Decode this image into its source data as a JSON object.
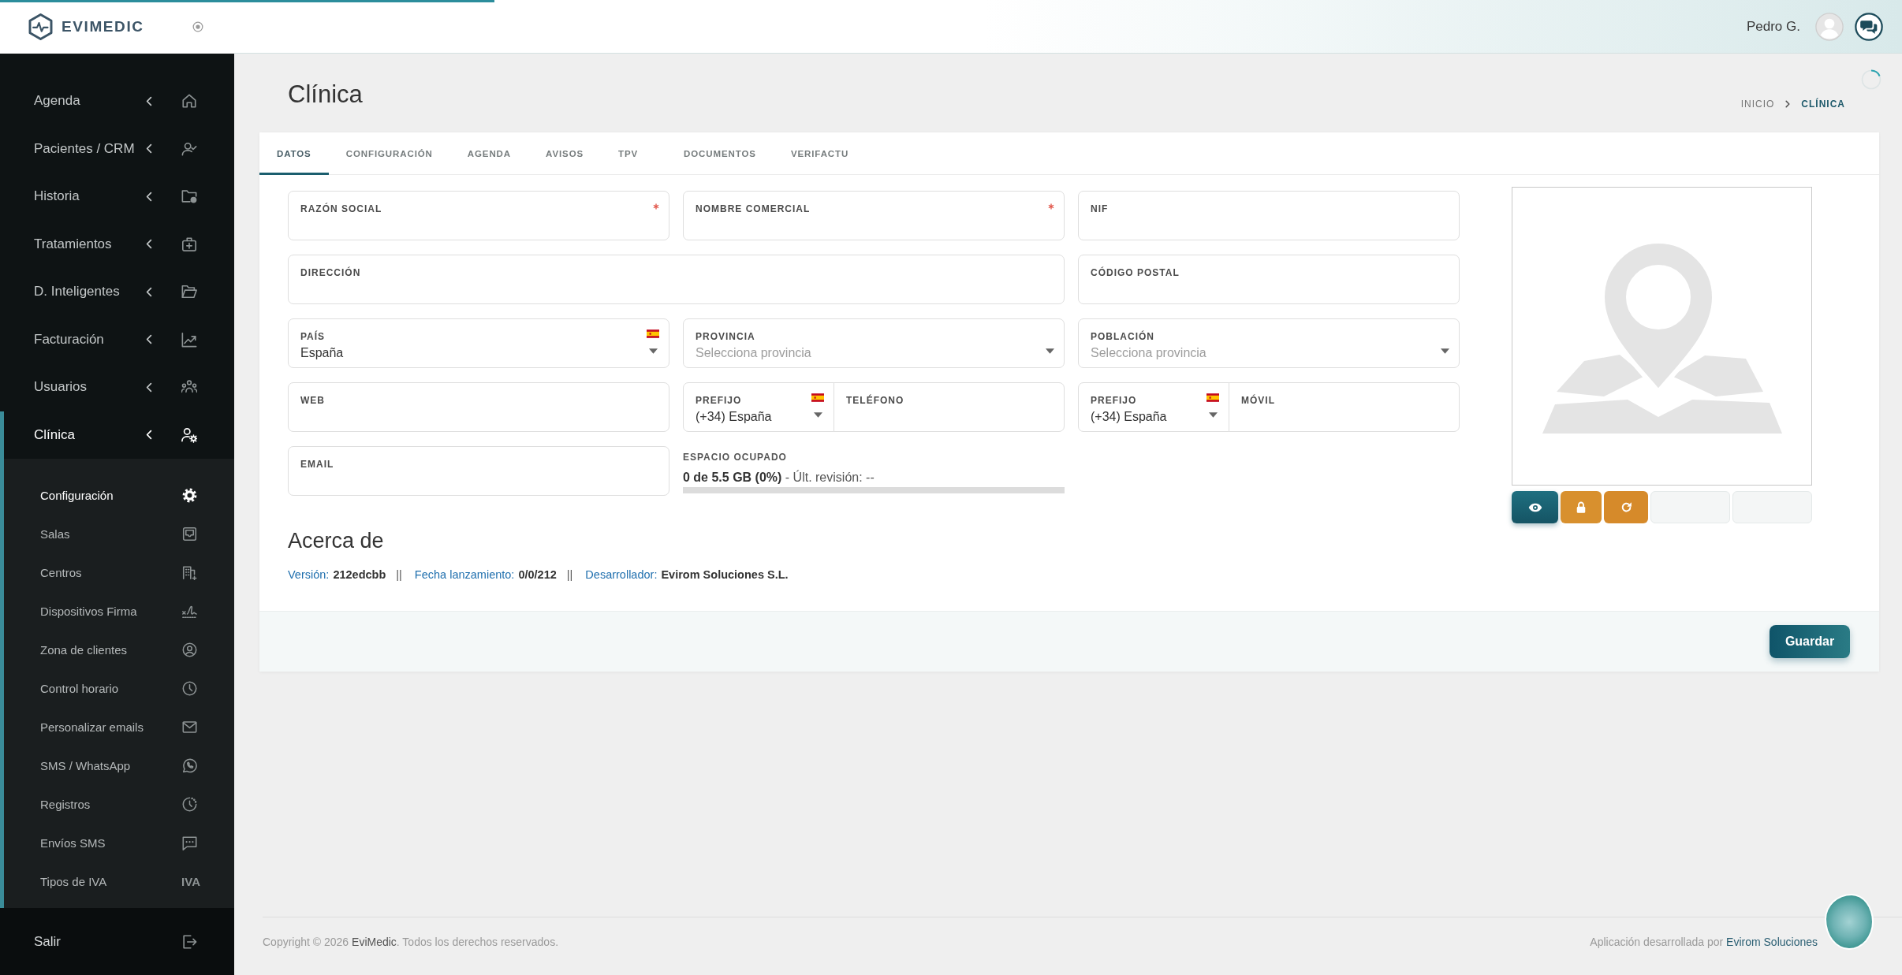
{
  "progress": {
    "level": 0.26
  },
  "brand": {
    "name": "EVIMEDIC"
  },
  "sidebar": {
    "items": [
      {
        "label": "Agenda",
        "selected": false
      },
      {
        "label": "Pacientes / CRM",
        "selected": false
      },
      {
        "label": "Historia",
        "selected": false
      },
      {
        "label": "Tratamientos",
        "selected": false
      },
      {
        "label": "D. Inteligentes",
        "selected": false
      },
      {
        "label": "Facturación",
        "selected": false
      },
      {
        "label": "Usuarios",
        "selected": false
      },
      {
        "label": "Clínica",
        "selected": true,
        "children": [
          {
            "label": "Configuración",
            "selected": true
          },
          {
            "label": "Salas",
            "selected": false
          },
          {
            "label": "Centros",
            "selected": false
          },
          {
            "label": "Dispositivos Firma",
            "selected": false
          },
          {
            "label": "Zona de clientes",
            "selected": false
          },
          {
            "label": "Control horario",
            "selected": false
          },
          {
            "label": "Personalizar emails",
            "selected": false
          },
          {
            "label": "SMS / WhatsApp",
            "selected": false
          },
          {
            "label": "Registros",
            "selected": false
          },
          {
            "label": "Envíos SMS",
            "selected": false
          },
          {
            "label": "Tipos de IVA",
            "selected": false,
            "badge": "IVA"
          }
        ]
      }
    ],
    "logout": {
      "label": "Salir"
    }
  },
  "header": {
    "user": "Pedro G."
  },
  "page": {
    "title": "Clínica",
    "breadcrumb": [
      {
        "label": "INICIO",
        "selected": false
      },
      {
        "label": "CLÍNICA",
        "selected": true
      }
    ]
  },
  "tabs": [
    {
      "label": "DATOS",
      "selected": true
    },
    {
      "label": "CONFIGURACIÓN",
      "selected": false
    },
    {
      "label": "AGENDA",
      "selected": false
    },
    {
      "label": "AVISOS",
      "selected": false
    },
    {
      "label": "TPV",
      "selected": false
    },
    {
      "label": "DOCUMENTOS",
      "selected": false
    },
    {
      "label": "VERIFACTU",
      "selected": false
    }
  ],
  "form": {
    "fields": [
      {
        "kind": "text",
        "label": "RAZÓN SOCIAL",
        "required": true
      },
      {
        "kind": "text",
        "label": "NOMBRE COMERCIAL",
        "required": true
      },
      {
        "kind": "text",
        "label": "NIF",
        "required": false
      },
      {
        "kind": "text",
        "label": "DIRECCIÓN",
        "required": false
      },
      {
        "kind": "text",
        "label": "CÓDIGO POSTAL",
        "required": false
      },
      {
        "kind": "country",
        "label": "PAÍS",
        "required": false,
        "value": "España"
      },
      {
        "kind": "select",
        "label": "PROVINCIA",
        "required": false,
        "placeholder": "Selecciona provincia"
      },
      {
        "kind": "select",
        "label": "POBLACIÓN",
        "required": false,
        "placeholder": "Selecciona provincia"
      },
      {
        "kind": "text",
        "label": "WEB",
        "required": false
      },
      {
        "kind": "phone",
        "prefix": {
          "label": "PREFIJO",
          "value": "(+34) España"
        },
        "number": {
          "label": "TELÉFONO"
        }
      },
      {
        "kind": "phone",
        "prefix": {
          "label": "PREFIJO",
          "value": "(+34) España"
        },
        "number": {
          "label": "MÓVIL"
        }
      },
      {
        "kind": "text",
        "label": "EMAIL",
        "required": false
      },
      {
        "kind": "storage",
        "label": "ESPACIO OCUPADO",
        "usage": "**0 de 5.5 GB (0%)** - Últ. revisión: --",
        "level": 0
      }
    ]
  },
  "image": {
    "actions": [
      {
        "kind": "view"
      },
      {
        "kind": "lock"
      },
      {
        "kind": "reload"
      },
      {
        "kind": "empty"
      },
      {
        "kind": "empty"
      }
    ]
  },
  "about": {
    "title": "Acerca de",
    "items": [
      {
        "label": "Versión:",
        "value": "212edcbb"
      },
      {
        "separator": "||",
        "label": "Fecha lanzamiento:",
        "value": "0/0/212"
      },
      {
        "separator": "||",
        "label": "Desarrollador:",
        "value": "Evirom Soluciones S.L."
      }
    ]
  },
  "actions": {
    "save": "Guardar"
  },
  "footer": {
    "copyright": {
      "text": "Copyright © 2026",
      "link": "EviMedic",
      "rest": ". Todos los derechos reservados."
    },
    "credit": {
      "text": "Aplicación desarrollada por",
      "link": "Evirom Soluciones"
    }
  }
}
